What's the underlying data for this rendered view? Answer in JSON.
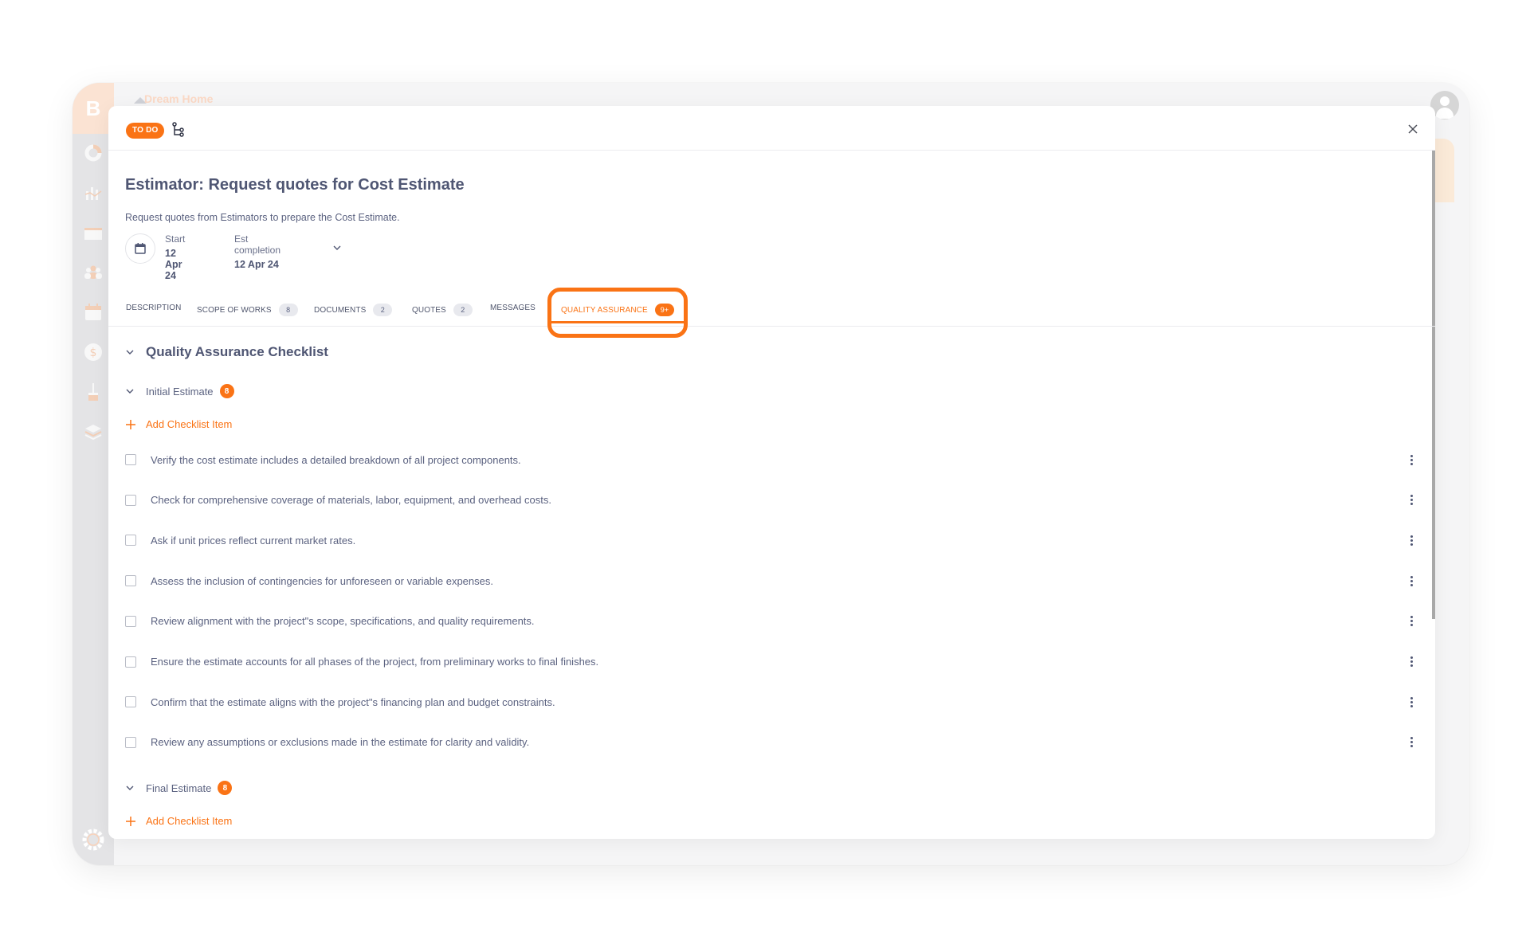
{
  "background_app": {
    "header_title": "Dream Home",
    "sidebar_icons": [
      "logo-icon",
      "dashboard-icon",
      "analytics-icon",
      "folder-icon",
      "team-icon",
      "calendar-icon",
      "finance-icon",
      "paintbrush-icon",
      "layers-icon",
      "settings-icon"
    ]
  },
  "modal": {
    "status": "TO DO",
    "title": "Estimator: Request quotes for Cost Estimate",
    "description": "Request quotes from Estimators to prepare the Cost Estimate.",
    "dates": {
      "start_label": "Start",
      "start_value": "12 Apr 24",
      "completion_label": "Est completion",
      "completion_value": "12 Apr 24"
    },
    "tabs": [
      {
        "label": "DESCRIPTION",
        "count": null,
        "active": false
      },
      {
        "label": "SCOPE OF WORKS",
        "count": "8",
        "active": false
      },
      {
        "label": "DOCUMENTS",
        "count": "2",
        "active": false
      },
      {
        "label": "QUOTES",
        "count": "2",
        "active": false
      },
      {
        "label": "MESSAGES",
        "count": null,
        "active": false
      },
      {
        "label": "QUALITY ASSURANCE",
        "count": "9+",
        "active": true
      }
    ],
    "checklist": {
      "title": "Quality Assurance Checklist",
      "add_label": "Add Checklist Item",
      "groups": [
        {
          "name": "Initial Estimate",
          "count": "8",
          "items": [
            "Verify the cost estimate includes a detailed breakdown of all project components.",
            "Check for comprehensive coverage of materials, labor, equipment, and overhead costs.",
            "Ask if unit prices reflect current market rates.",
            "Assess the inclusion of contingencies for unforeseen or variable expenses.",
            "Review alignment with the project\"s scope, specifications, and quality requirements.",
            "Ensure the estimate accounts for all phases of the project, from preliminary works to final finishes.",
            "Confirm that the estimate aligns with the project\"s financing plan and budget constraints.",
            "Review any assumptions or exclusions made in the estimate for clarity and validity."
          ]
        },
        {
          "name": "Final Estimate",
          "count": "8",
          "items": []
        }
      ]
    }
  },
  "colors": {
    "accent": "#fa7315",
    "text_primary": "#4f5673",
    "text_secondary": "#5b6280"
  }
}
